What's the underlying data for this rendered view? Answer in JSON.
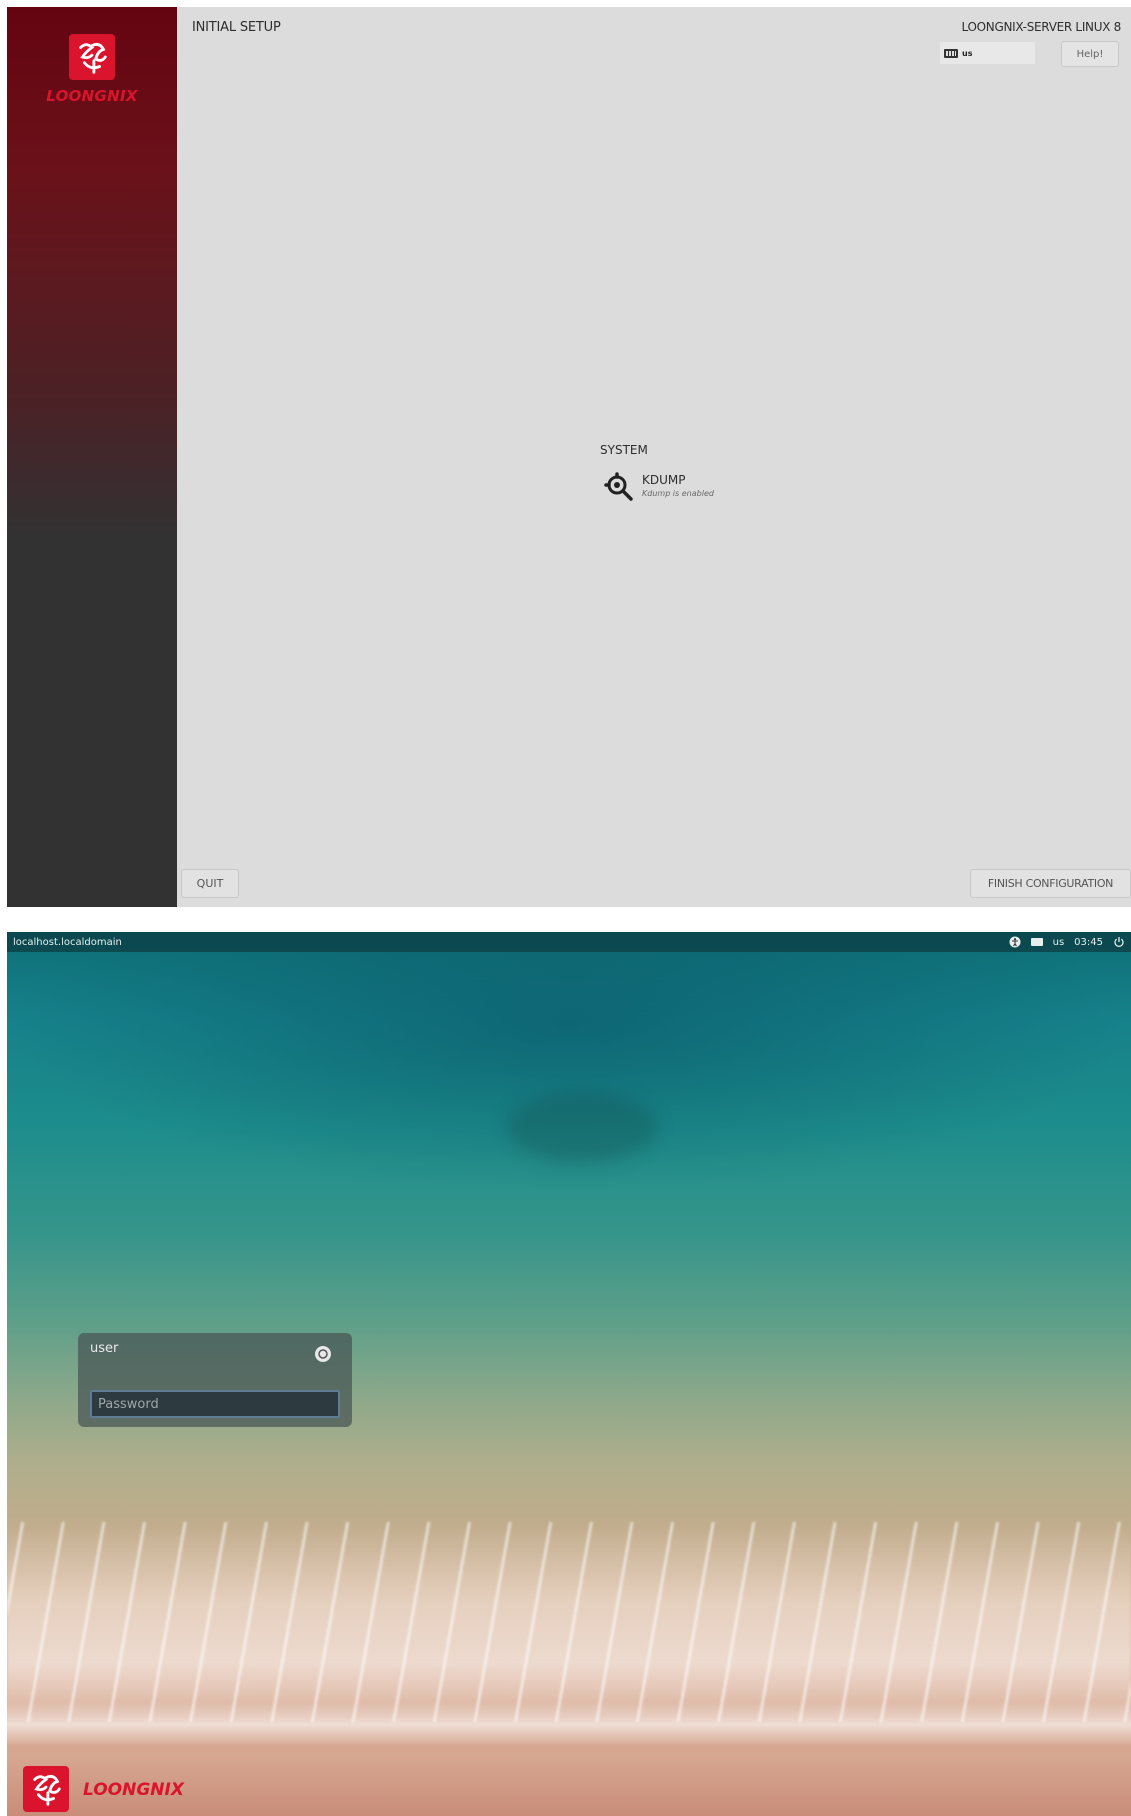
{
  "setup": {
    "brand": "LOONGNIX",
    "title": "INITIAL SETUP",
    "product": "LOONGNIX-SERVER LINUX 8",
    "keyboard_layout": "us",
    "help_label": "Help!",
    "section_title": "SYSTEM",
    "spoke": {
      "title": "KDUMP",
      "status": "Kdump is enabled",
      "icon": "kdump-magnifier-icon"
    },
    "quit_label": "QUIT",
    "finish_label": "FINISH CONFIGURATION",
    "colors": {
      "background": "#dcdcdc",
      "sidebar_top": "#650411",
      "sidebar_bottom": "#323232",
      "brand_red": "#d9142c"
    }
  },
  "login": {
    "hostname": "localhost.localdomain",
    "tray": {
      "accessibility_icon": "accessibility-icon",
      "keyboard_icon": "keyboard-icon",
      "keyboard_layout": "us",
      "time": "03:45",
      "power_icon": "power-icon"
    },
    "username": "user",
    "password_placeholder": "Password",
    "brand": "LOONGNIX"
  }
}
